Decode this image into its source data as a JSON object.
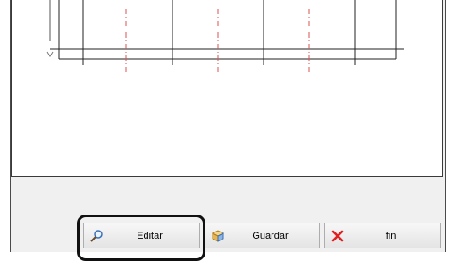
{
  "buttons": {
    "edit_label": "Editar",
    "save_label": "Guardar",
    "close_label": "fin"
  },
  "icons": {
    "edit": "magnifier-icon",
    "save": "box-icon",
    "close": "red-x-icon"
  },
  "colors": {
    "axis_dash": "#d9534f",
    "grid_line": "#222222",
    "close_red": "#e02020"
  }
}
